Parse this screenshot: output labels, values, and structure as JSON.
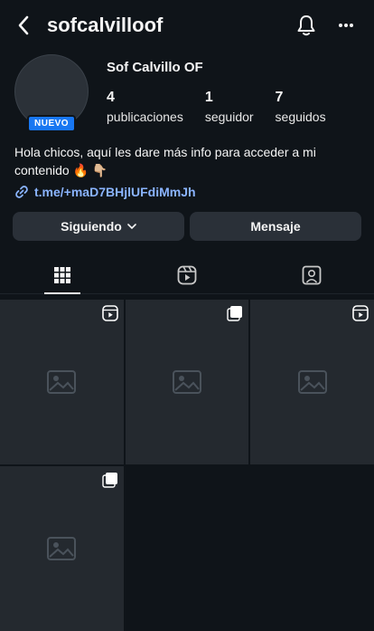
{
  "header": {
    "username": "sofcalvilloof",
    "back_icon": "chevron-left-icon",
    "bell_icon": "bell-icon",
    "more_icon": "more-horizontal-icon"
  },
  "profile": {
    "display_name": "Sof Calvillo OF",
    "badge": "NUEVO",
    "stats": [
      {
        "value": "4",
        "label": "publicaciones"
      },
      {
        "value": "1",
        "label": "seguidor"
      },
      {
        "value": "7",
        "label": "seguidos"
      }
    ],
    "bio": "Hola chicos, aquí les dare más info para acceder a mi contenido 🔥 👇🏼",
    "link": "t.me/+maD7BHjlUFdiMmJh"
  },
  "actions": {
    "follow_label": "Siguiendo",
    "message_label": "Mensaje"
  },
  "tabs": [
    {
      "icon": "grid-icon",
      "active": true
    },
    {
      "icon": "reels-icon",
      "active": false
    },
    {
      "icon": "tagged-icon",
      "active": false
    }
  ],
  "posts": [
    {
      "type_icon": "reel-icon"
    },
    {
      "type_icon": "multi-post-icon"
    },
    {
      "type_icon": "reel-icon"
    },
    {
      "type_icon": "multi-post-icon"
    }
  ],
  "colors": {
    "background": "#0f1419",
    "button": "#2a3038",
    "link": "#8ab4ff",
    "badge": "#1877f2"
  }
}
